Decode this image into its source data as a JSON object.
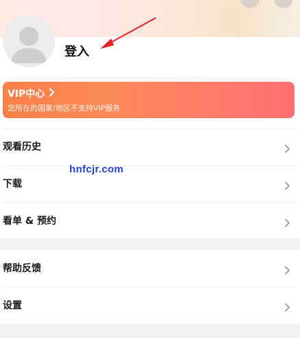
{
  "profile": {
    "login_label": "登入"
  },
  "vip": {
    "title": "VIP中心",
    "subtitle": "您所在的国家/地区不支持VIP服务",
    "gradient_start": "#f97f48",
    "gradient_end": "#ff6f72"
  },
  "menu_primary": [
    {
      "label": "观看历史",
      "icon": "chevron-right-icon"
    },
    {
      "label": "下载",
      "icon": "chevron-right-icon"
    },
    {
      "label": "看单 & 预约",
      "icon": "chevron-right-icon"
    }
  ],
  "menu_secondary": [
    {
      "label": "帮助反馈",
      "icon": "chevron-right-icon"
    },
    {
      "label": "设置",
      "icon": "chevron-right-icon"
    }
  ],
  "watermark": "hnfcjr.com",
  "colors": {
    "annotation_arrow": "#e8202a",
    "watermark": "#2340d6",
    "page_background": "#f2f2f2"
  }
}
